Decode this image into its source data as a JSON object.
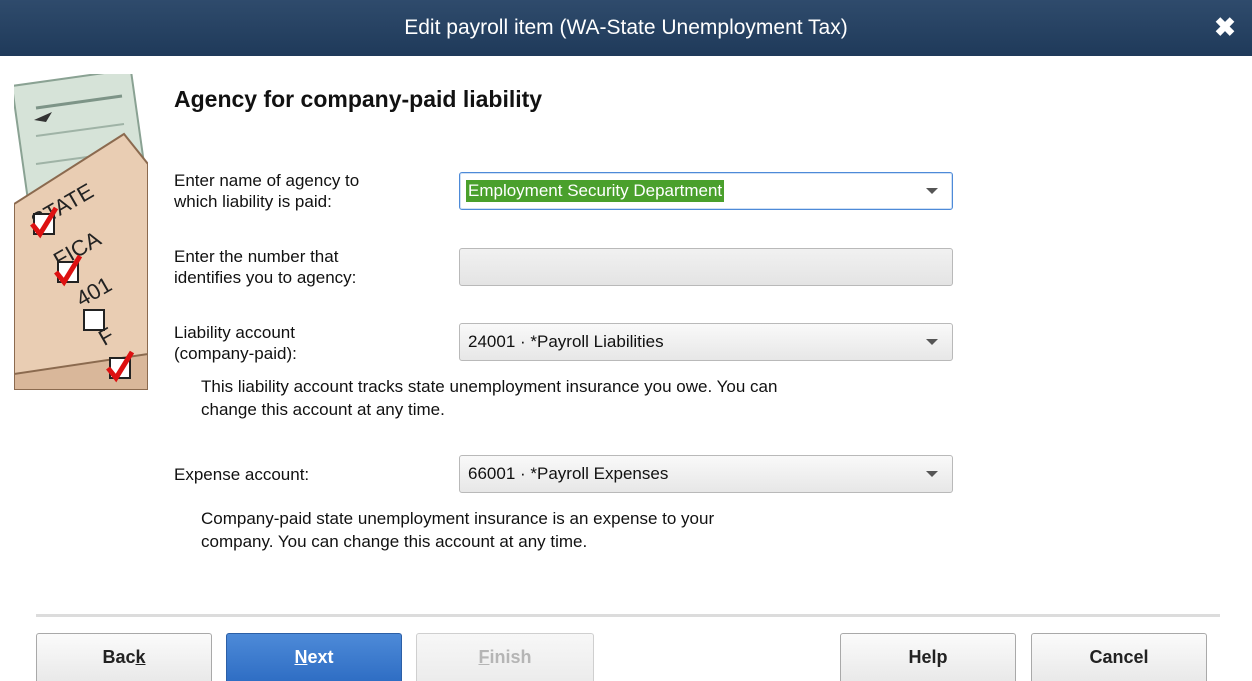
{
  "window": {
    "title": "Edit payroll item (WA-State Unemployment Tax)",
    "close_glyph": "✖"
  },
  "sidebar_image": {
    "icon": "payroll-checklist-illustration",
    "items": [
      "STATE",
      "FICA",
      "401",
      "F"
    ]
  },
  "page": {
    "heading": "Agency for company-paid liability"
  },
  "form": {
    "agency_label_line1": "Enter name of agency to",
    "agency_label_line2": "which liability is paid:",
    "agency_value": "Employment Security Department",
    "agency_number_label_line1": "Enter the number that",
    "agency_number_label_line2": "identifies you to agency:",
    "agency_number_value": "",
    "liability_label_line1": "Liability account",
    "liability_label_line2": "(company-paid):",
    "liability_value": "24001 · *Payroll Liabilities",
    "liability_help_line1": "This liability account tracks state unemployment insurance you owe. You can",
    "liability_help_line2": "change this account at any time.",
    "expense_label": "Expense account:",
    "expense_value": "66001 · *Payroll Expenses",
    "expense_help_line1": "Company-paid state unemployment insurance is an expense to your",
    "expense_help_line2": "company. You can change this account at any time."
  },
  "buttons": {
    "back_pre": "Bac",
    "back_mnemonic": "k",
    "next_mnemonic": "N",
    "next_post": "ext",
    "finish_mnemonic": "F",
    "finish_post": "inish",
    "help": "Help",
    "cancel": "Cancel"
  },
  "colors": {
    "titlebar": "#2f4b6c",
    "selection_highlight": "#4aa02c",
    "primary_button": "#3b7bd0",
    "focus_border": "#4d8ad8"
  }
}
